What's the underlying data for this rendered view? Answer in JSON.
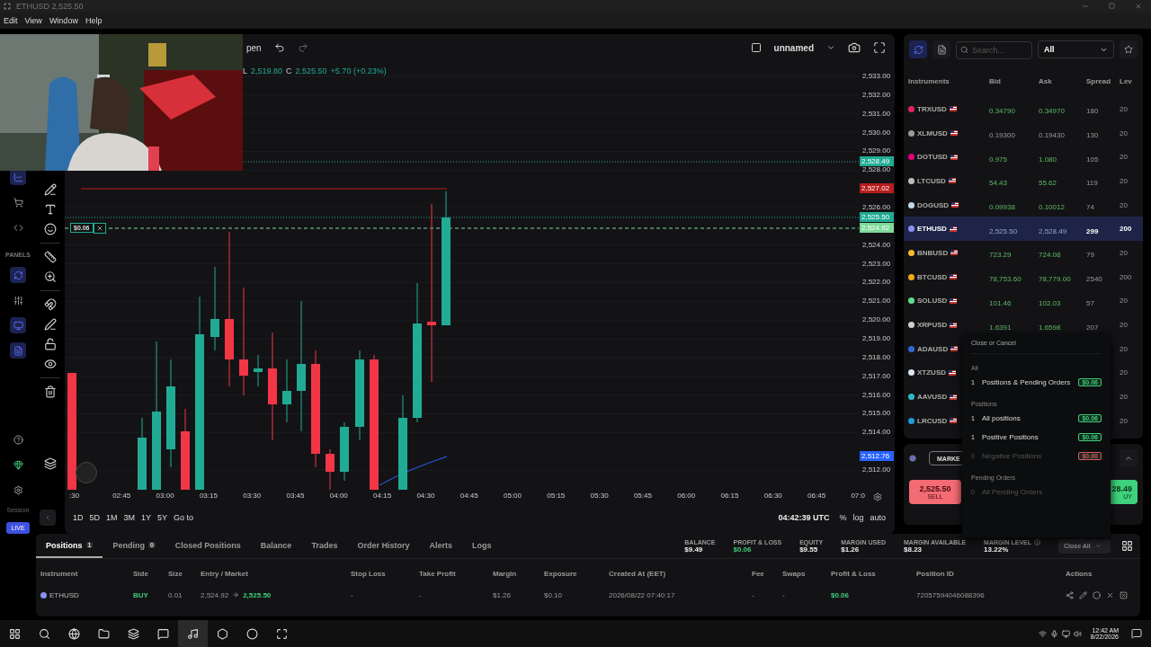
{
  "window": {
    "title": "ETHUSD 2,525.50"
  },
  "menu": [
    "Edit",
    "View",
    "Window",
    "Help"
  ],
  "webcam": {
    "kind": "picture"
  },
  "chart_toolbar": {
    "open_label": "pen",
    "layout_name": "unnamed"
  },
  "ohlc": [
    {
      "key": "L",
      "value": "2,519.80"
    },
    {
      "key": "C",
      "value": "2,525.50"
    }
  ],
  "change": "+5.70 (+0.23%)",
  "price_axis": [
    "2,533.00",
    "2,532.00",
    "2,531.00",
    "2,530.00",
    "2,529.00",
    "2,528.00",
    "2,526.00",
    "2,524.00",
    "2,523.00",
    "2,522.00",
    "2,521.00",
    "2,520.00",
    "2,519.00",
    "2,518.00",
    "2,517.00",
    "2,516.00",
    "2,515.00",
    "2,514.00",
    "2,512.00"
  ],
  "price_tags": [
    {
      "text": "2,528.49",
      "color": "#22ab94"
    },
    {
      "text": "2,527.02",
      "color": "#b71c1c"
    },
    {
      "text": "2,525.50",
      "color": "#22ab94"
    },
    {
      "text": "2,524.92",
      "color": "#7ed99a"
    },
    {
      "text": "2,512.76",
      "color": "#2962ff"
    }
  ],
  "position_line": {
    "pnl": "$0.06"
  },
  "time_axis": [
    ":30",
    "02:45",
    "03:00",
    "03:15",
    "03:30",
    "03:45",
    "04:00",
    "04:15",
    "04:30",
    "04:45",
    "05:00",
    "05:15",
    "05:30",
    "05:45",
    "06:00",
    "06:15",
    "06:30",
    "06:45",
    "07:0"
  ],
  "ranges": [
    "1D",
    "5D",
    "1M",
    "3M",
    "1Y",
    "5Y"
  ],
  "goto": "Go to",
  "clock": "04:42:39 UTC",
  "scale_options": [
    "%",
    "log",
    "auto"
  ],
  "sidebar": {
    "section": "PANELS",
    "session": "Session",
    "live": "LIVE"
  },
  "instruments": {
    "search_placeholder": "Search...",
    "filter": "All",
    "columns": [
      "Instruments",
      "Bid",
      "Ask",
      "Spread",
      "Lev"
    ],
    "rows": [
      {
        "symbol": "TRXUSD",
        "color": "#e0245e",
        "bid": "0.34790",
        "ask": "0.34970",
        "spread": "180",
        "leverage": "20",
        "kind": "up",
        "selected": false
      },
      {
        "symbol": "XLMUSD",
        "color": "#9a9a9a",
        "bid": "0.19300",
        "ask": "0.19430",
        "spread": "130",
        "leverage": "20",
        "kind": "flat",
        "selected": false
      },
      {
        "symbol": "DOTUSD",
        "color": "#e6007a",
        "bid": "0.975",
        "ask": "1.080",
        "spread": "105",
        "leverage": "20",
        "kind": "up",
        "selected": false
      },
      {
        "symbol": "LTCUSD",
        "color": "#bfbbbb",
        "bid": "54.43",
        "ask": "55.62",
        "spread": "119",
        "leverage": "20",
        "kind": "up",
        "selected": false
      },
      {
        "symbol": "DOGUSD",
        "color": "#c2d8e8",
        "bid": "0.09938",
        "ask": "0.10012",
        "spread": "74",
        "leverage": "20",
        "kind": "up",
        "selected": false
      },
      {
        "symbol": "ETHUSD",
        "color": "#8a92f0",
        "bid": "2,525.50",
        "ask": "2,528.49",
        "spread": "299",
        "leverage": "200",
        "kind": "up",
        "selected": true
      },
      {
        "symbol": "BNBUSD",
        "color": "#f3ba2f",
        "bid": "723.29",
        "ask": "724.08",
        "spread": "79",
        "leverage": "20",
        "kind": "up",
        "selected": false
      },
      {
        "symbol": "BTCUSD",
        "color": "#f7a61a",
        "bid": "78,753.60",
        "ask": "78,779.00",
        "spread": "2540",
        "leverage": "200",
        "kind": "up",
        "selected": false
      },
      {
        "symbol": "SOLUSD",
        "color": "#5fe08c",
        "bid": "101.46",
        "ask": "102.03",
        "spread": "57",
        "leverage": "20",
        "kind": "up",
        "selected": false
      },
      {
        "symbol": "XRPUSD",
        "color": "#cfcfcf",
        "bid": "1.6391",
        "ask": "1.6598",
        "spread": "207",
        "leverage": "20",
        "kind": "up",
        "selected": false
      },
      {
        "symbol": "ADAUSD",
        "color": "#3468d1",
        "leverage": "20",
        "selected": false
      },
      {
        "symbol": "XTZUSD",
        "color": "#d8e4f0",
        "leverage": "20",
        "selected": false
      },
      {
        "symbol": "AAVUSD",
        "color": "#2ebac6",
        "leverage": "20",
        "selected": false
      },
      {
        "symbol": "LRCUSD",
        "color": "#1c9cd8",
        "leverage": "20",
        "selected": false
      }
    ]
  },
  "order": {
    "type": "MARKE",
    "sell": {
      "price": "2,525.50",
      "label": "SELL"
    },
    "buy": {
      "price": "28.49",
      "label": "UY"
    }
  },
  "close_menu": {
    "title": "Close or Cancel",
    "sections": [
      {
        "title": "All",
        "items": [
          {
            "count": "1",
            "label": "Positions & Pending Orders",
            "amount": "$0.06",
            "color": "#3fcf7a",
            "disabled": false
          }
        ]
      },
      {
        "title": "Positions",
        "items": [
          {
            "count": "1",
            "label": "All positions",
            "amount": "$0.06",
            "color": "#3fcf7a",
            "disabled": false
          },
          {
            "count": "1",
            "label": "Positive Positions",
            "amount": "$0.06",
            "color": "#3fcf7a",
            "disabled": false
          },
          {
            "count": "0",
            "label": "Negative Positions",
            "amount": "$0.00",
            "color": "#e05560",
            "disabled": true
          }
        ]
      },
      {
        "title": "Pending Orders",
        "items": [
          {
            "count": "0",
            "label": "All Pending Orders",
            "disabled": true
          }
        ]
      }
    ]
  },
  "bottom_tabs": [
    {
      "label": "Positions",
      "count": "1",
      "selected": true
    },
    {
      "label": "Pending",
      "count": "0",
      "selected": false
    },
    {
      "label": "Closed Positions",
      "selected": false
    },
    {
      "label": "Balance",
      "selected": false
    },
    {
      "label": "Trades",
      "selected": false
    },
    {
      "label": "Order History",
      "selected": false
    },
    {
      "label": "Alerts",
      "selected": false
    },
    {
      "label": "Logs",
      "selected": false
    }
  ],
  "account": [
    {
      "label": "BALANCE",
      "value": "$9.49",
      "color": "#eeeeee"
    },
    {
      "label": "PROFIT & LOSS",
      "value": "$0.06",
      "color": "#3fcf7a"
    },
    {
      "label": "EQUITY",
      "value": "$9.55",
      "color": "#eeeeee"
    },
    {
      "label": "MARGIN USED",
      "value": "$1.26",
      "color": "#eeeeee"
    },
    {
      "label": "MARGIN AVAILABLE",
      "value": "$8.23",
      "color": "#eeeeee"
    },
    {
      "label": "MARGIN LEVEL",
      "value": "13.22%",
      "color": "#eeeeee",
      "info": true
    }
  ],
  "close_all": "Close All",
  "positions": {
    "columns": [
      "Instrument",
      "Side",
      "Size",
      "Entry / Market",
      "Stop Loss",
      "Take Profit",
      "Margin",
      "Exposure",
      "Created At (EET)",
      "Fee",
      "Swaps",
      "Profit & Loss",
      "Position ID",
      "Actions"
    ],
    "rows": [
      {
        "instrument": "ETHUSD",
        "side": "BUY",
        "size": "0.01",
        "entry": "2,524.92",
        "market": "2,525.50",
        "stop_loss": "-",
        "take_profit": "-",
        "margin": "$1.26",
        "exposure": "$0.10",
        "created": "2026/08/22 07:40:17",
        "fee": "-",
        "swaps": "-",
        "pnl": "$0.06",
        "position_id": "72057594046088396"
      }
    ]
  },
  "taskbar": {
    "time": "12:42 AM",
    "date": "8/22/2026",
    "apps": [
      {
        "kind": "chrome",
        "active": false
      },
      {
        "kind": "folder",
        "active": false
      },
      {
        "kind": "archive",
        "active": false
      },
      {
        "kind": "chat",
        "active": false
      },
      {
        "kind": "music",
        "active": true
      },
      {
        "kind": "tool",
        "active": false
      },
      {
        "kind": "browser",
        "active": false
      },
      {
        "kind": "app",
        "active": false
      }
    ]
  }
}
